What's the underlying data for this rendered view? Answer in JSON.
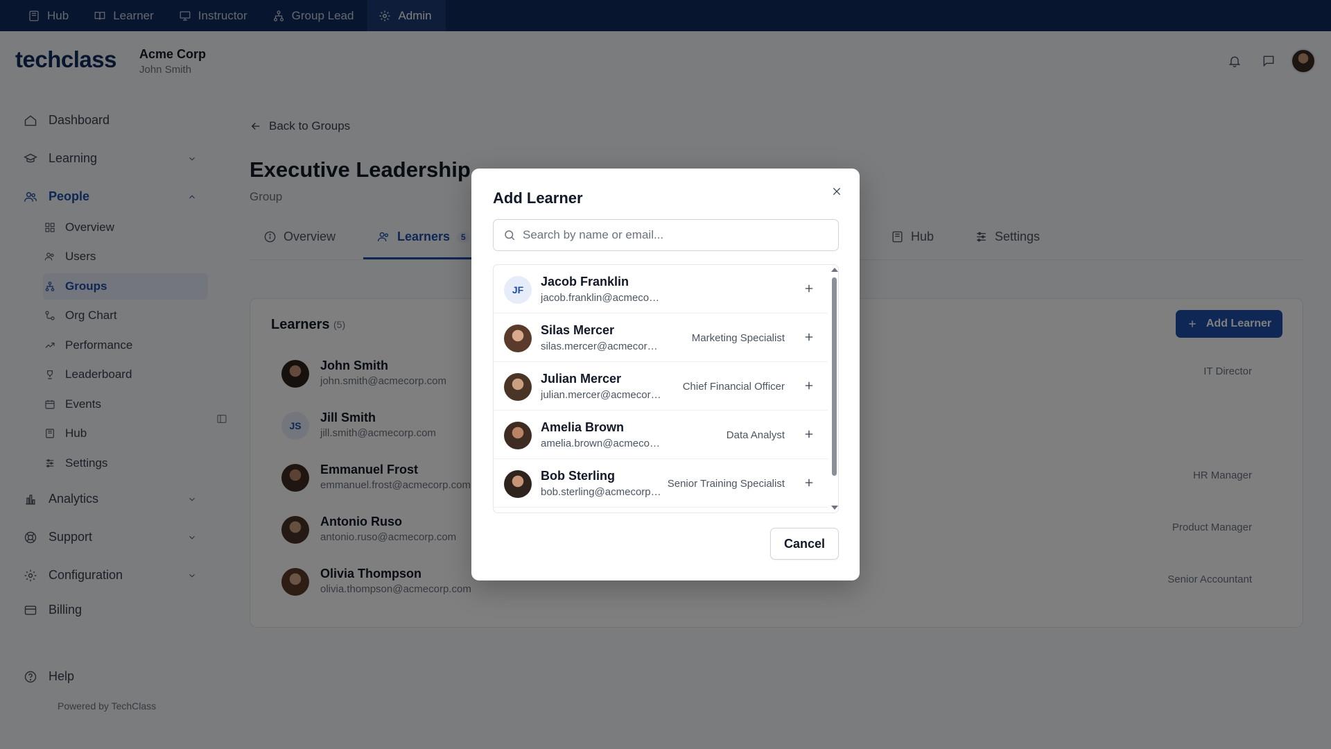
{
  "top_nav": {
    "items": [
      {
        "label": "Hub",
        "icon": "book-icon"
      },
      {
        "label": "Learner",
        "icon": "open-book-icon"
      },
      {
        "label": "Instructor",
        "icon": "presentation-icon"
      },
      {
        "label": "Group Lead",
        "icon": "hierarchy-icon"
      },
      {
        "label": "Admin",
        "icon": "gear-icon",
        "active": true
      }
    ]
  },
  "header": {
    "logo": "techclass",
    "org_name": "Acme Corp",
    "user_name": "John Smith"
  },
  "sidebar": {
    "items": [
      {
        "label": "Dashboard",
        "icon": "home-icon"
      },
      {
        "label": "Learning",
        "icon": "graduation-cap-icon"
      },
      {
        "label": "People",
        "icon": "users-icon",
        "open": true
      },
      {
        "label": "Analytics",
        "icon": "bar-chart-icon"
      },
      {
        "label": "Support",
        "icon": "lifebuoy-icon"
      },
      {
        "label": "Configuration",
        "icon": "gear-icon"
      },
      {
        "label": "Billing",
        "icon": "credit-card-icon"
      }
    ],
    "people_sub": [
      {
        "label": "Overview",
        "icon": "grid-icon"
      },
      {
        "label": "Users",
        "icon": "users-icon"
      },
      {
        "label": "Groups",
        "icon": "hierarchy-icon",
        "active": true
      },
      {
        "label": "Org Chart",
        "icon": "org-chart-icon"
      },
      {
        "label": "Performance",
        "icon": "trend-icon"
      },
      {
        "label": "Leaderboard",
        "icon": "trophy-icon"
      },
      {
        "label": "Events",
        "icon": "calendar-icon"
      },
      {
        "label": "Hub",
        "icon": "book-icon"
      },
      {
        "label": "Settings",
        "icon": "sliders-icon"
      }
    ],
    "help": "Help",
    "powered_by": "Powered by TechClass"
  },
  "page": {
    "back_label": "Back to Groups",
    "title": "Executive Leadership",
    "subtitle": "Group",
    "tabs": [
      {
        "label": "Overview",
        "icon": "info-icon"
      },
      {
        "label": "Learners",
        "icon": "users-icon",
        "badge": "5",
        "active": true
      },
      {
        "label": "Hub",
        "icon": "book-icon"
      },
      {
        "label": "Settings",
        "icon": "sliders-icon"
      }
    ],
    "learners_card": {
      "title": "Learners",
      "count": "(5)",
      "add_button": "Add Learner",
      "rows": [
        {
          "name": "John Smith",
          "email": "john.smith@acmecorp.com",
          "role": "IT Director"
        },
        {
          "name": "Jill Smith",
          "initials": "JS",
          "email": "jill.smith@acmecorp.com",
          "role": ""
        },
        {
          "name": "Emmanuel Frost",
          "email": "emmanuel.frost@acmecorp.com",
          "role": "HR Manager"
        },
        {
          "name": "Antonio Ruso",
          "email": "antonio.ruso@acmecorp.com",
          "role": "Product Manager"
        },
        {
          "name": "Olivia Thompson",
          "email": "olivia.thompson@acmecorp.com",
          "role": "Senior Accountant"
        }
      ]
    }
  },
  "modal": {
    "title": "Add Learner",
    "search_placeholder": "Search by name or email...",
    "results": [
      {
        "name": "Jacob Franklin",
        "initials": "JF",
        "email": "jacob.franklin@acmecorp.com",
        "role": ""
      },
      {
        "name": "Silas Mercer",
        "email": "silas.mercer@acmecorp.com",
        "role": "Marketing Specialist"
      },
      {
        "name": "Julian Mercer",
        "email": "julian.mercer@acmecorp.com",
        "role": "Chief Financial Officer"
      },
      {
        "name": "Amelia Brown",
        "email": "amelia.brown@acmecorp.com",
        "role": "Data Analyst"
      },
      {
        "name": "Bob Sterling",
        "email": "bob.sterling@acmecorp.com",
        "role": "Senior Training Specialist"
      }
    ],
    "cancel_label": "Cancel"
  },
  "colors": {
    "nav_bg": "#0f2a5c",
    "accent": "#1e4fa8",
    "logo_accent": "#f5a623"
  }
}
